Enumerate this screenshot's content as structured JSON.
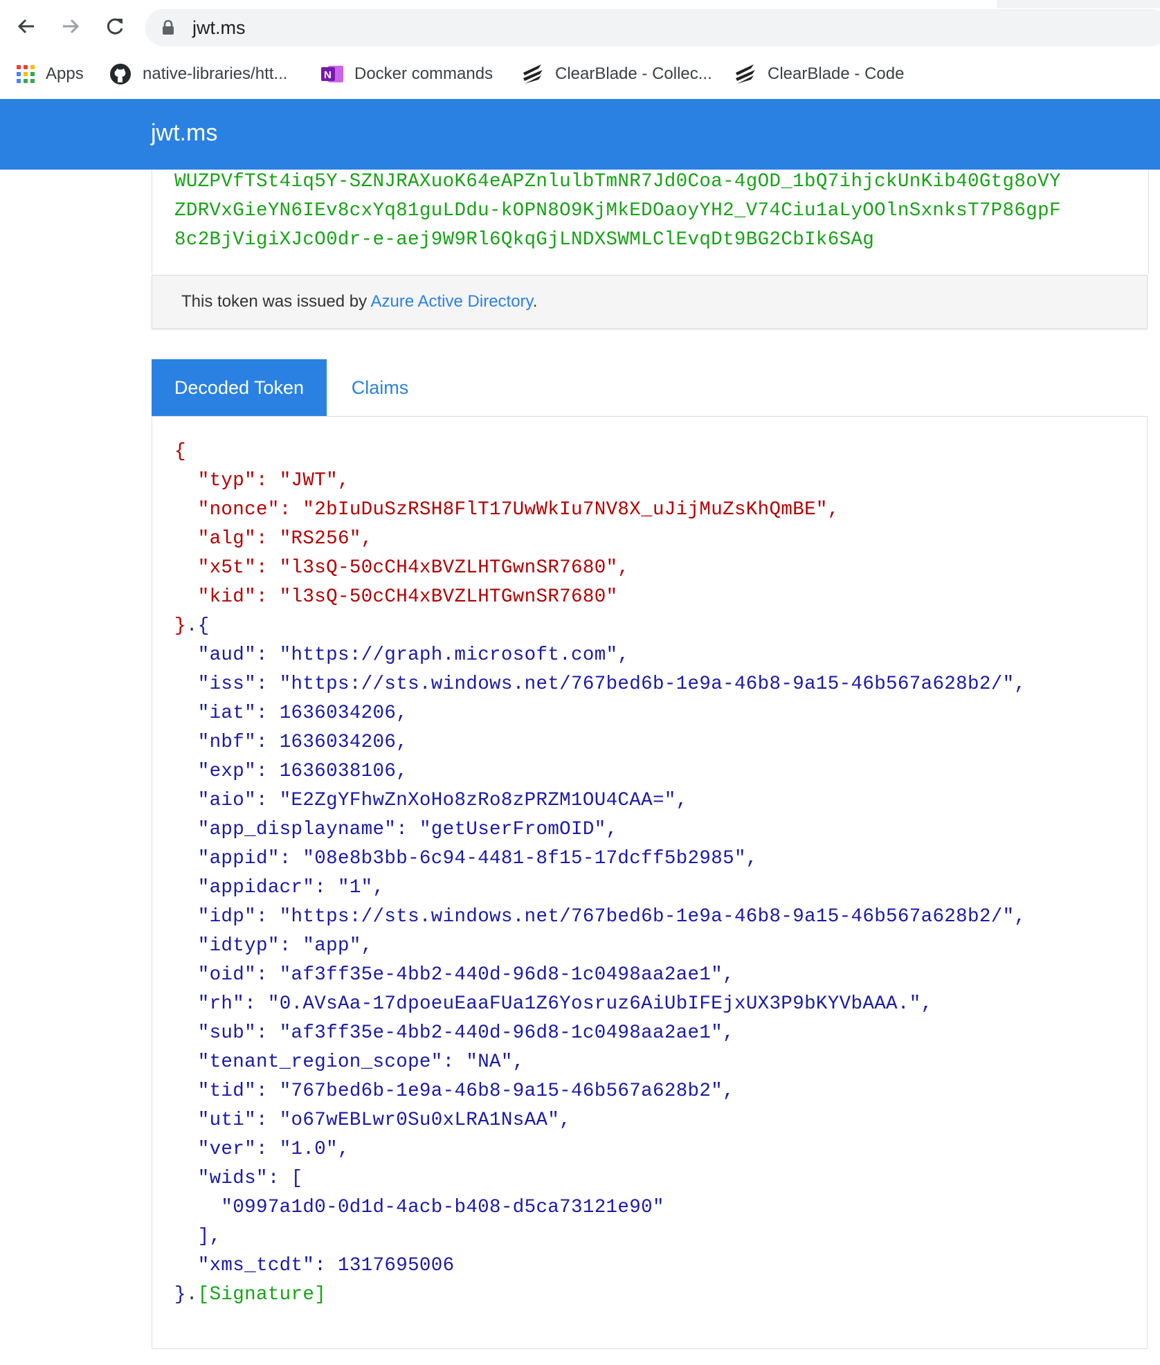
{
  "browser": {
    "url": "jwt.ms",
    "bookmarks": [
      "Apps",
      "native-libraries/htt...",
      "Docker commands",
      "ClearBlade - Collec...",
      "ClearBlade - Code"
    ]
  },
  "site": {
    "title": "jwt.ms"
  },
  "encoded": {
    "lines": [
      "WUZPVfTSt4iq5Y-SZNJRAXuoK64eAPZnlulbTmNR7Jd0Coa-4gOD_1bQ7ihjckUnKib40Gtg8oVY",
      "ZDRVxGieYN6IEv8cxYq81guLDdu-kOPN8O9KjMkEDOaoyYH2_V74Ciu1aLyOOlnSxnksT7P86gpF",
      "8c2BjVigiXJcO0dr-e-aej9W9Rl6QkqGjLNDXSWMLClEvqDt9BG2CbIk6SAg"
    ]
  },
  "issuer": {
    "prefix": "This token was issued by ",
    "link": "Azure Active Directory",
    "suffix": "."
  },
  "tabs": [
    "Decoded Token",
    "Claims"
  ],
  "decoded": {
    "header": [
      {
        "key": "\"typ\"",
        "value": "\"JWT\","
      },
      {
        "key": "\"nonce\"",
        "value": "\"2bIuDuSzRSH8FlT17UwWkIu7NV8X_uJijMuZsKhQmBE\","
      },
      {
        "key": "\"alg\"",
        "value": "\"RS256\","
      },
      {
        "key": "\"x5t\"",
        "value": "\"l3sQ-50cCH4xBVZLHTGwnSR7680\","
      },
      {
        "key": "\"kid\"",
        "value": "\"l3sQ-50cCH4xBVZLHTGwnSR7680\""
      }
    ],
    "payload": [
      {
        "key": "\"aud\"",
        "value": "\"https://graph.microsoft.com\","
      },
      {
        "key": "\"iss\"",
        "value": "\"https://sts.windows.net/767bed6b-1e9a-46b8-9a15-46b567a628b2/\","
      },
      {
        "key": "\"iat\"",
        "value": "1636034206,"
      },
      {
        "key": "\"nbf\"",
        "value": "1636034206,"
      },
      {
        "key": "\"exp\"",
        "value": "1636038106,"
      },
      {
        "key": "\"aio\"",
        "value": "\"E2ZgYFhwZnXoHo8zRo8zPRZM1OU4CAA=\","
      },
      {
        "key": "\"app_displayname\"",
        "value": "\"getUserFromOID\","
      },
      {
        "key": "\"appid\"",
        "value": "\"08e8b3bb-6c94-4481-8f15-17dcff5b2985\","
      },
      {
        "key": "\"appidacr\"",
        "value": "\"1\","
      },
      {
        "key": "\"idp\"",
        "value": "\"https://sts.windows.net/767bed6b-1e9a-46b8-9a15-46b567a628b2/\","
      },
      {
        "key": "\"idtyp\"",
        "value": "\"app\","
      },
      {
        "key": "\"oid\"",
        "value": "\"af3ff35e-4bb2-440d-96d8-1c0498aa2ae1\","
      },
      {
        "key": "\"rh\"",
        "value": "\"0.AVsAa-17dpoeuEaaFUa1Z6Yosruz6AiUbIFEjxUX3P9bKYVbAAA.\","
      },
      {
        "key": "\"sub\"",
        "value": "\"af3ff35e-4bb2-440d-96d8-1c0498aa2ae1\","
      },
      {
        "key": "\"tenant_region_scope\"",
        "value": "\"NA\","
      },
      {
        "key": "\"tid\"",
        "value": "\"767bed6b-1e9a-46b8-9a15-46b567a628b2\","
      },
      {
        "key": "\"uti\"",
        "value": "\"o67wEBLwr0Su0xLRA1NsAA\","
      },
      {
        "key": "\"ver\"",
        "value": "\"1.0\","
      },
      {
        "key": "\"wids\"",
        "value": "["
      }
    ],
    "wids_item": "\"0997a1d0-0d1d-4acb-b408-d5ca73121e90\"",
    "wids_close": "],",
    "last": {
      "key": "\"xms_tcdt\"",
      "value": "1317695006"
    },
    "signature": "[Signature]"
  },
  "colors": {
    "header_blue": "#2a81e2",
    "token_green": "#16a316",
    "json_red": "#b40000",
    "json_blue": "#1a1aa6"
  }
}
